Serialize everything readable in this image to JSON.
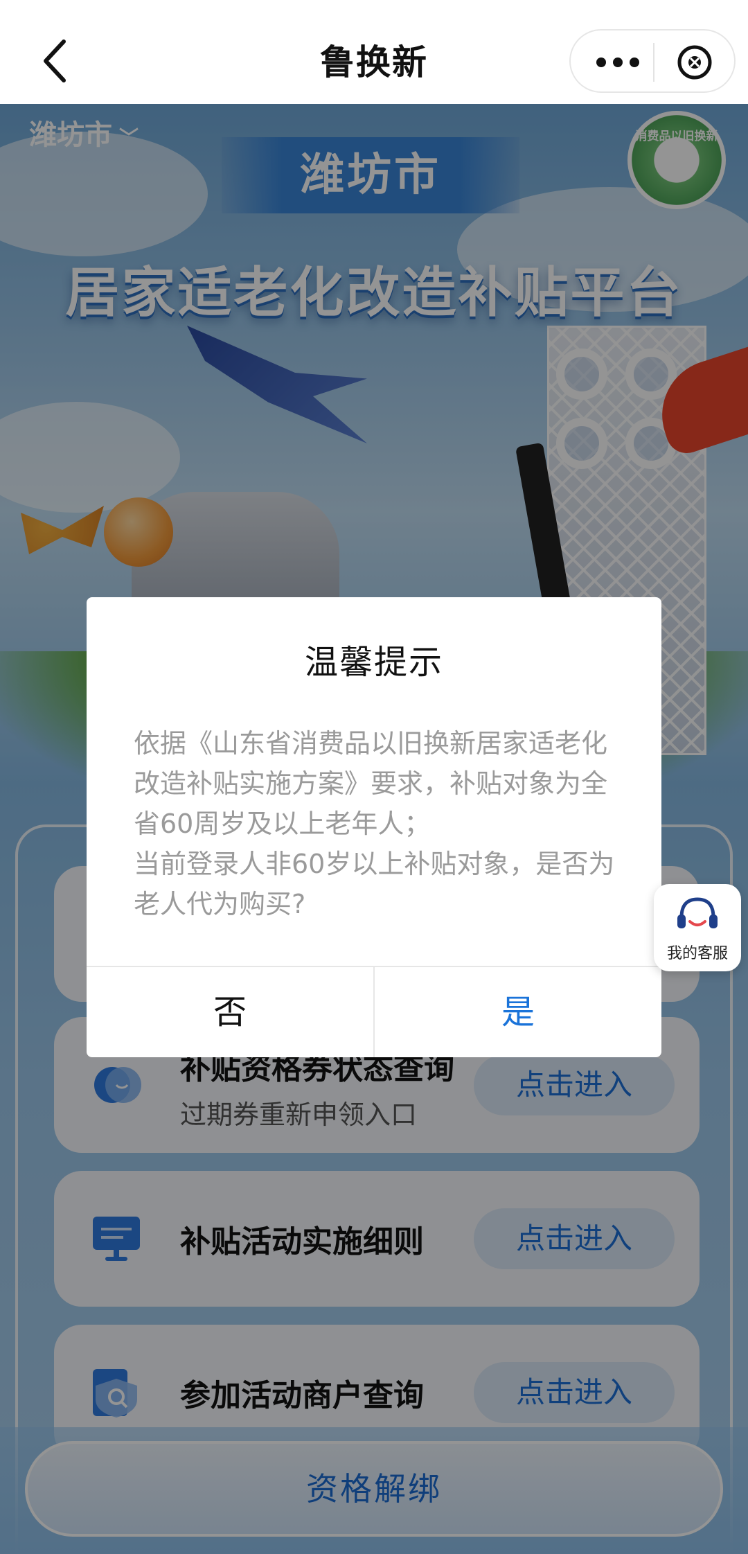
{
  "navbar": {
    "title": "鲁换新",
    "back_icon": "chevron-left-icon",
    "more_icon": "more-dots-icon",
    "close_icon": "close-circle-icon"
  },
  "hero": {
    "city_selector": "潍坊市",
    "city_banner": "潍坊市",
    "platform_title": "居家适老化改造补贴平台",
    "badge_text": "消费品以旧换新"
  },
  "cards": [
    {
      "title": "补贴资格券状态查询",
      "subtitle": "过期券重新申领入口",
      "button": "点击进入",
      "icon": "chat-bubble-icon"
    },
    {
      "title": "补贴活动实施细则",
      "button": "点击进入",
      "icon": "monitor-icon"
    },
    {
      "title": "参加活动商户查询",
      "button": "点击进入",
      "icon": "shield-search-icon"
    }
  ],
  "bottom_button": "资格解绑",
  "service": {
    "label": "我的客服",
    "icon": "headset-icon"
  },
  "dialog": {
    "title": "温馨提示",
    "body": "依据《山东省消费品以旧换新居家适老化改造补贴实施方案》要求，补贴对象为全省60周岁及以上老年人；\n当前登录人非60岁以上补贴对象，是否为老人代为购买?",
    "no_label": "否",
    "yes_label": "是"
  },
  "colors": {
    "accent_blue": "#1a73d9",
    "mask": "rgba(0,0,0,0.42)"
  }
}
